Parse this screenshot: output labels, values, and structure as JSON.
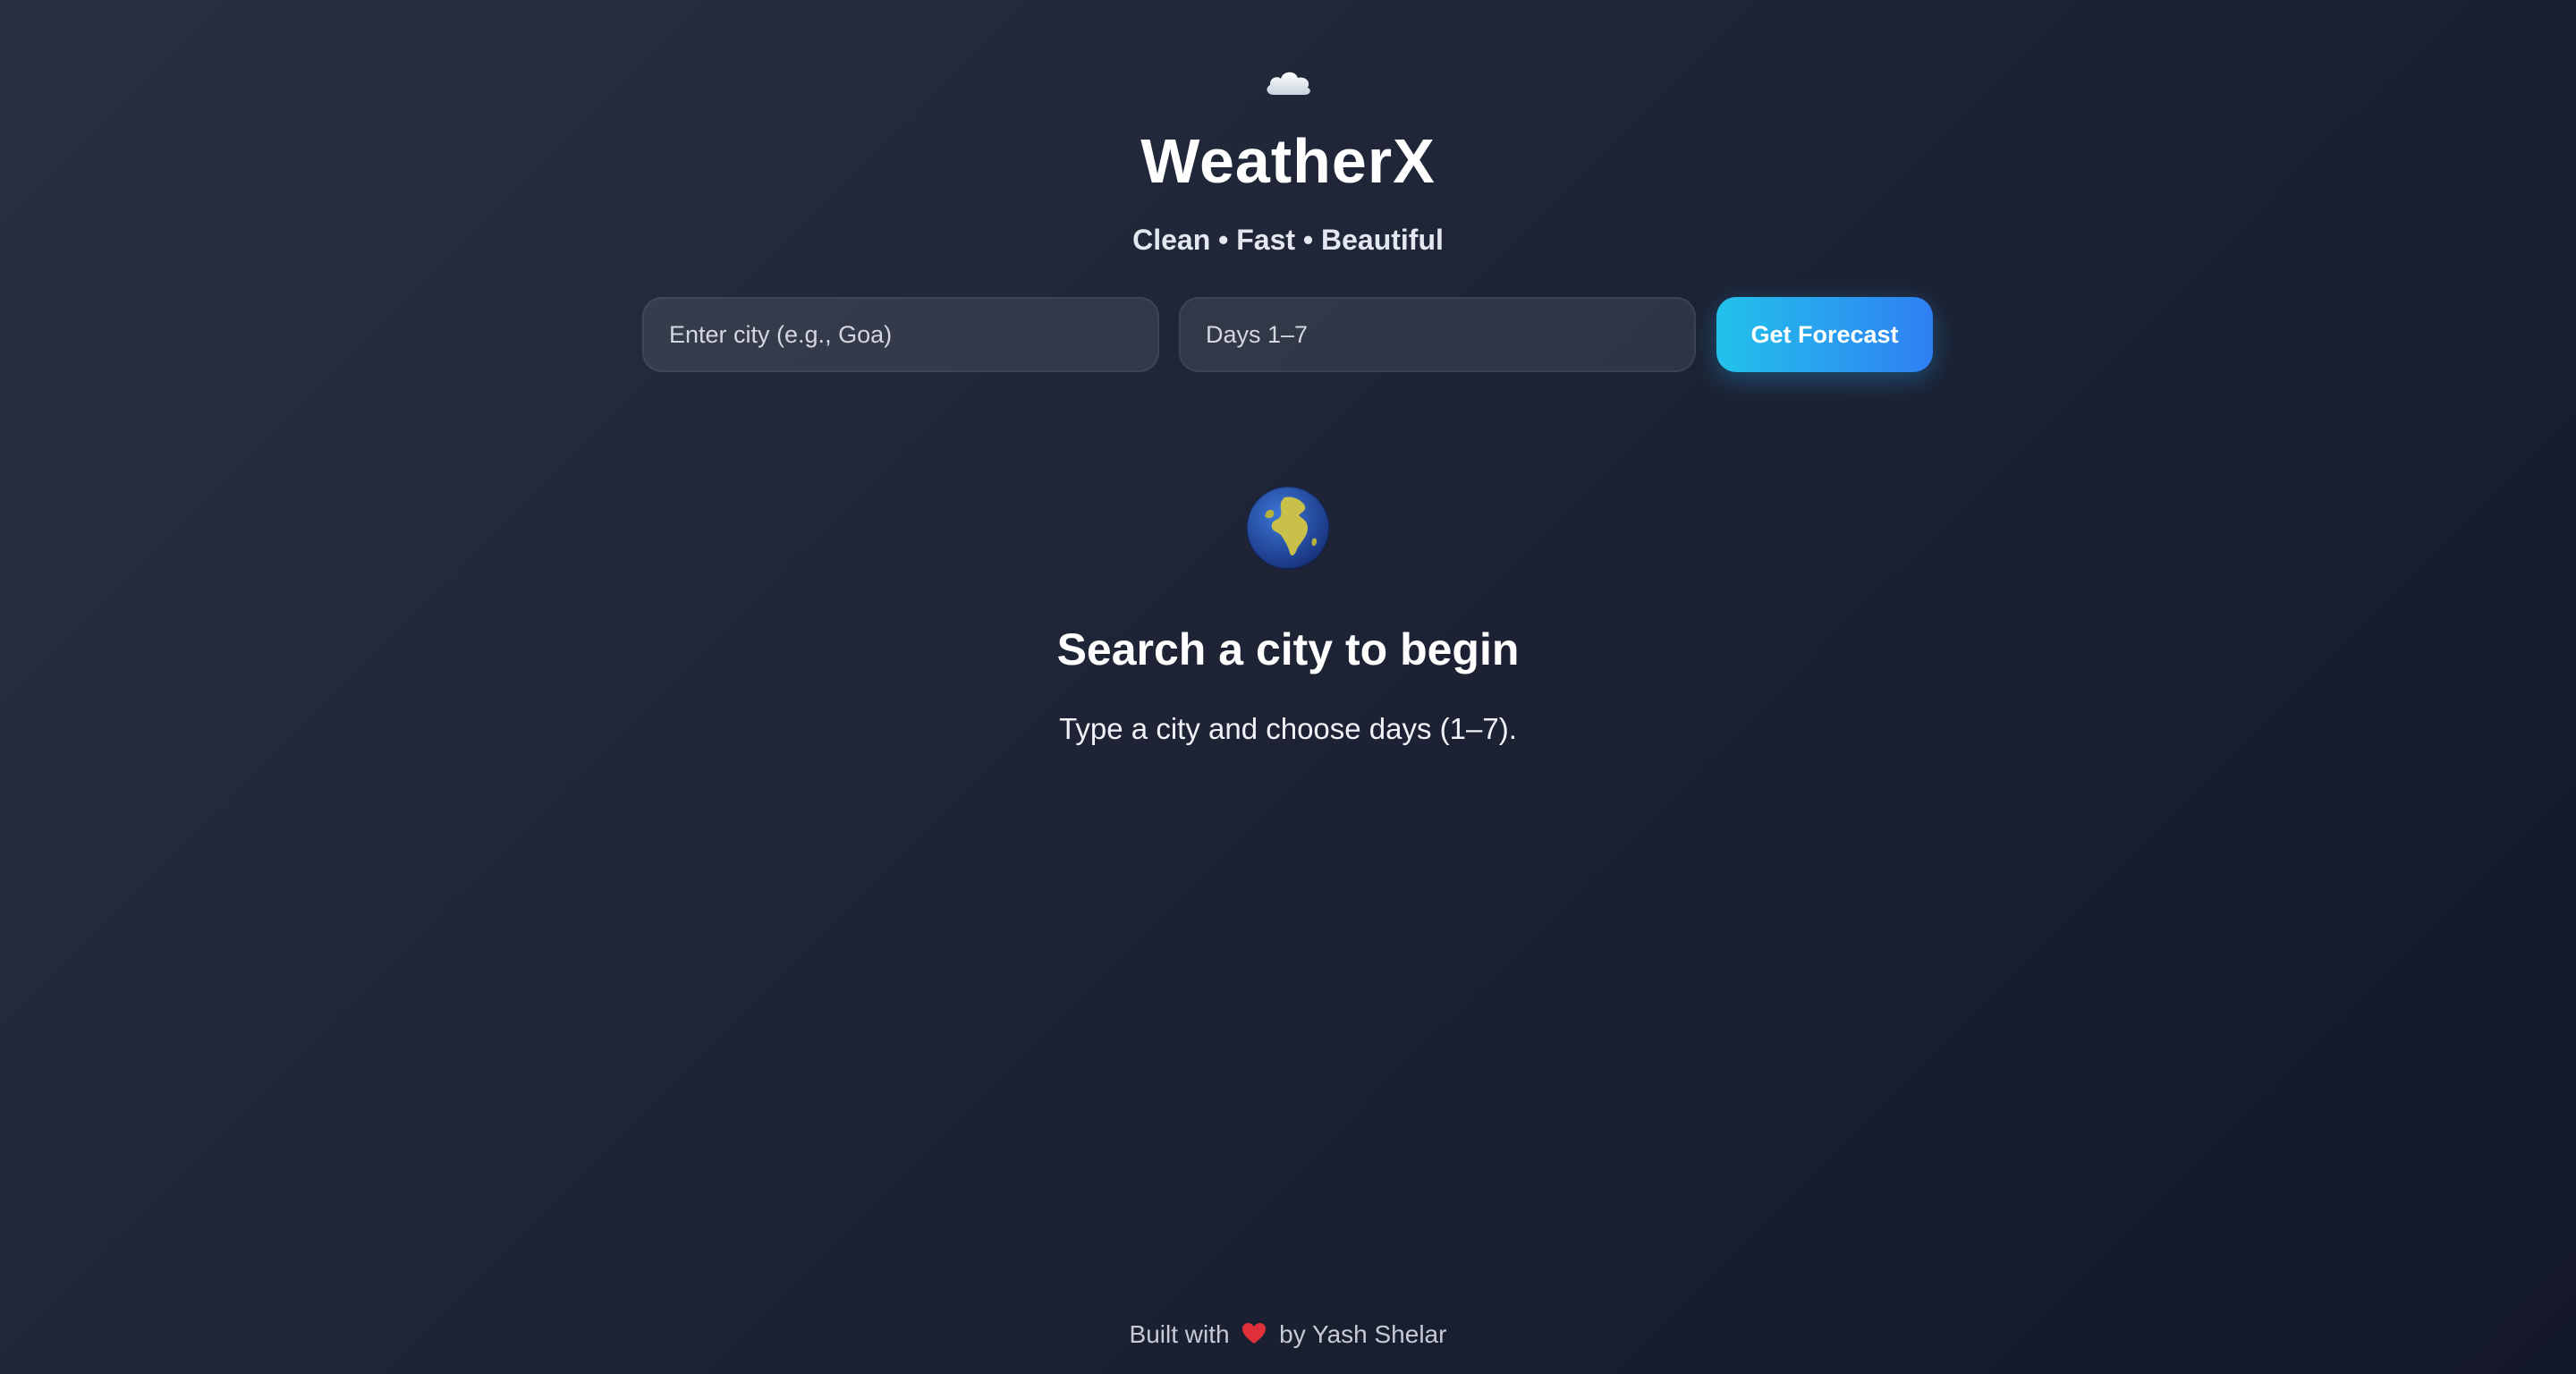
{
  "header": {
    "logo_icon": "cloud-icon",
    "title": "WeatherX",
    "tagline": "Clean • Fast • Beautiful"
  },
  "search": {
    "city_placeholder": "Enter city (e.g., Goa)",
    "city_value": "",
    "days_placeholder": "Days 1–7",
    "days_value": "",
    "submit_label": "Get Forecast"
  },
  "empty_state": {
    "icon": "globe-icon",
    "title": "Search a city to begin",
    "subtitle": "Type a city and choose days (1–7)."
  },
  "footer": {
    "prefix": "Built with",
    "icon": "heart-icon",
    "suffix": "by Yash Shelar"
  },
  "colors": {
    "background_top": "#283042",
    "background_bottom": "#131829",
    "accent_start": "#22c2ea",
    "accent_end": "#2f7ff3",
    "heart": "#e0303a"
  }
}
